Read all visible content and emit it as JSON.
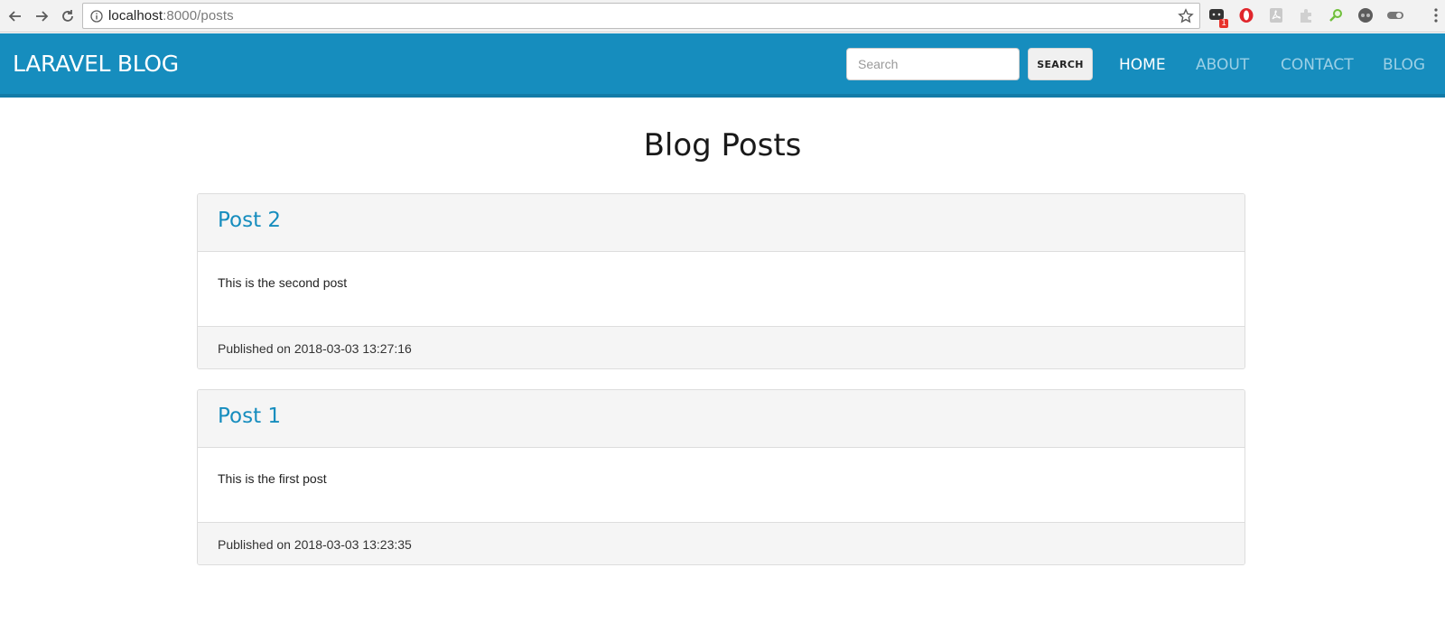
{
  "browser": {
    "url_host": "localhost",
    "url_rest": ":8000/posts",
    "extension_badge": "1"
  },
  "navbar": {
    "brand": "LARAVEL BLOG",
    "search_placeholder": "Search",
    "search_button": "SEARCH",
    "links": [
      {
        "label": "HOME",
        "active": true
      },
      {
        "label": "ABOUT",
        "active": false
      },
      {
        "label": "CONTACT",
        "active": false
      },
      {
        "label": "BLOG",
        "active": false
      }
    ]
  },
  "main": {
    "title": "Blog Posts",
    "posts": [
      {
        "title": "Post 2",
        "body": "This is the second post",
        "published": "Published on 2018-03-03 13:27:16"
      },
      {
        "title": "Post 1",
        "body": "This is the first post",
        "published": "Published on 2018-03-03 13:23:35"
      }
    ]
  },
  "colors": {
    "navbar_bg": "#168dbe",
    "link": "#168dbe",
    "nav_inactive": "#9cd0e6"
  }
}
